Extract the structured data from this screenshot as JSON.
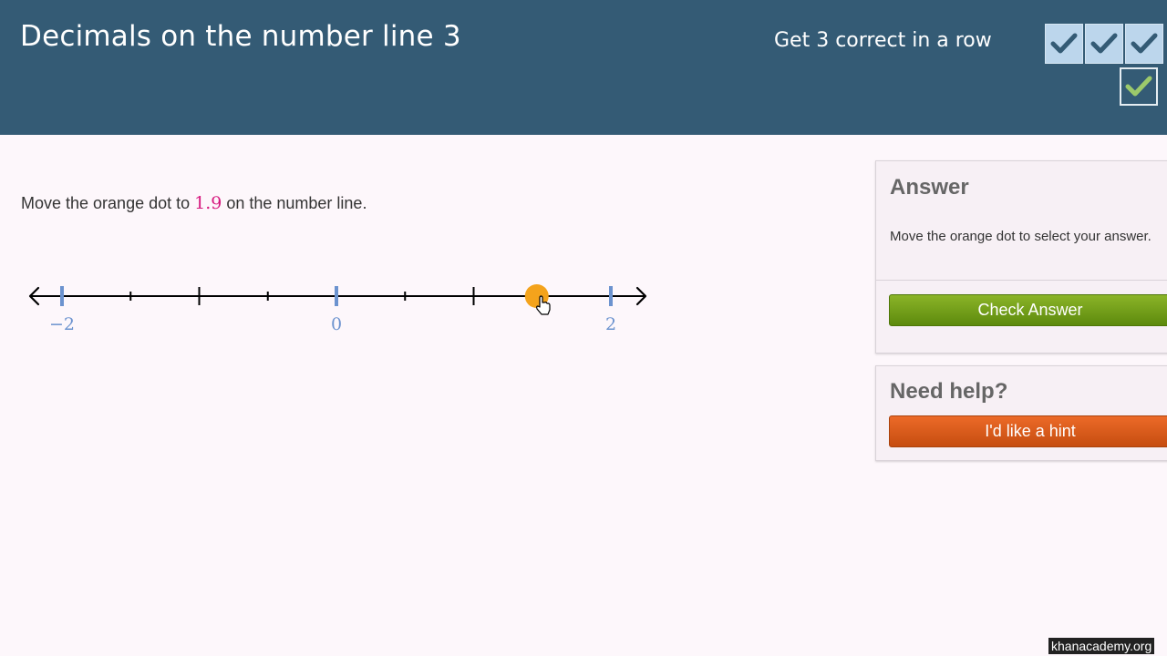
{
  "header": {
    "title": "Decimals on the number line 3",
    "streak_label": "Get 3 correct in a row",
    "streak_icons": [
      "check-icon",
      "check-icon",
      "check-icon"
    ],
    "summary_icon": "check-icon",
    "colors": {
      "background": "#345b75",
      "streak_check": "#345b75",
      "summary_check": "#9cc96b"
    }
  },
  "question": {
    "prefix": "Move the orange dot to ",
    "target": "1.9",
    "suffix": " on the number line."
  },
  "number_line": {
    "min": -2.5,
    "max": 2.5,
    "labels": [
      "−2",
      "0",
      "2"
    ],
    "dot_value": 1.5,
    "dot_color": "#f4a31c",
    "label_color": "#6c93cf"
  },
  "answer_panel": {
    "heading": "Answer",
    "instruction": "Move the orange dot to select your answer.",
    "check_button": "Check Answer"
  },
  "help_panel": {
    "heading": "Need help?",
    "hint_button": "I'd like a hint"
  },
  "watermark": "khanacademy.org"
}
